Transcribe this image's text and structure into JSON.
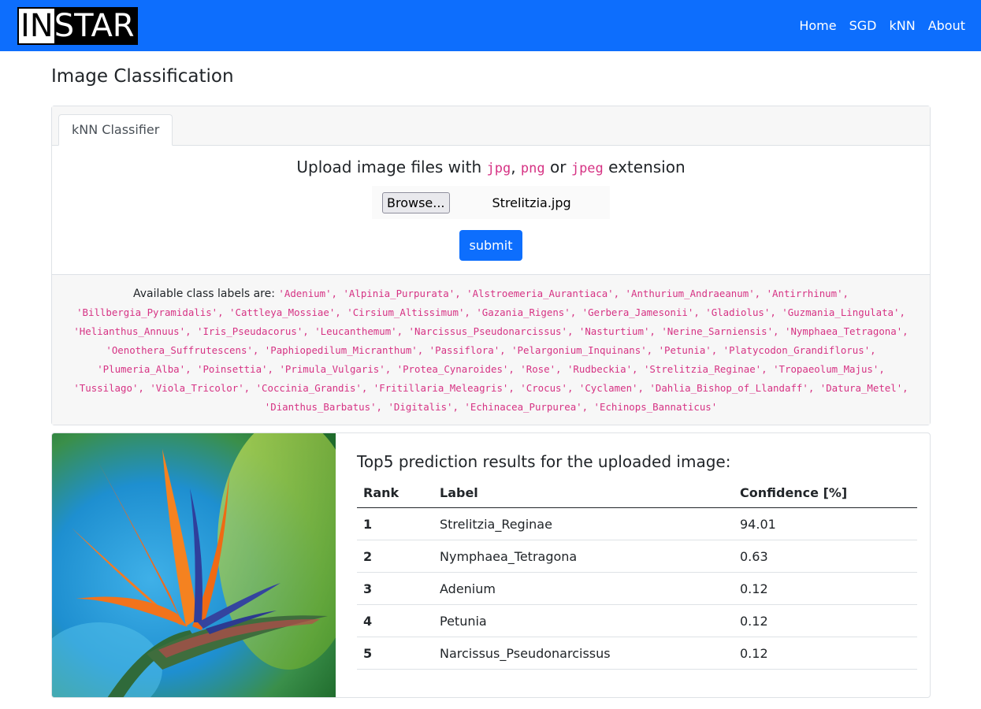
{
  "navbar": {
    "logo_in": "IN",
    "logo_star": "STAR",
    "links": [
      "Home",
      "SGD",
      "kNN",
      "About"
    ]
  },
  "page_title": "Image Classification",
  "tab_label": "kNN Classifier",
  "upload": {
    "title_prefix": "Upload image files with ",
    "ext1": "jpg",
    "sep1": ", ",
    "ext2": "png",
    "sep2": " or ",
    "ext3": "jpeg",
    "title_suffix": " extension",
    "browse_label": "Browse...",
    "file_name": "Strelitzia.jpg",
    "submit_label": "submit"
  },
  "classes": {
    "label": "Available class labels are: ",
    "list": "'Adenium', 'Alpinia_Purpurata', 'Alstroemeria_Aurantiaca', 'Anthurium_Andraeanum', 'Antirrhinum', 'Billbergia_Pyramidalis', 'Cattleya_Mossiae', 'Cirsium_Altissimum', 'Gazania_Rigens', 'Gerbera_Jamesonii', 'Gladiolus', 'Guzmania_Lingulata', 'Helianthus_Annuus', 'Iris_Pseudacorus', 'Leucanthemum', 'Narcissus_Pseudonarcissus', 'Nasturtium', 'Nerine_Sarniensis', 'Nymphaea_Tetragona', 'Oenothera_Suffrutescens', 'Paphiopedilum_Micranthum', 'Passiflora', 'Pelargonium_Inquinans', 'Petunia', 'Platycodon_Grandiflorus', 'Plumeria_Alba', 'Poinsettia', 'Primula_Vulgaris', 'Protea_Cynaroides', 'Rose', 'Rudbeckia', 'Strelitzia_Reginae', 'Tropaeolum_Majus', 'Tussilago', 'Viola_Tricolor', 'Coccinia_Grandis', 'Fritillaria_Meleagris', 'Crocus', 'Cyclamen', 'Dahlia_Bishop_of_Llandaff', 'Datura_Metel', 'Dianthus_Barbatus', 'Digitalis', 'Echinacea_Purpurea', 'Echinops_Bannaticus'"
  },
  "results": {
    "title": "Top5 prediction results for the uploaded image:",
    "headers": {
      "rank": "Rank",
      "label": "Label",
      "confidence": "Confidence [%]"
    },
    "rows": [
      {
        "rank": "1",
        "label": "Strelitzia_Reginae",
        "confidence": "94.01"
      },
      {
        "rank": "2",
        "label": "Nymphaea_Tetragona",
        "confidence": "0.63"
      },
      {
        "rank": "3",
        "label": "Adenium",
        "confidence": "0.12"
      },
      {
        "rank": "4",
        "label": "Petunia",
        "confidence": "0.12"
      },
      {
        "rank": "5",
        "label": "Narcissus_Pseudonarcissus",
        "confidence": "0.12"
      }
    ]
  },
  "colors": {
    "navbar": "#0d6efd",
    "code": "#d63384",
    "submit": "#0d6efd"
  }
}
